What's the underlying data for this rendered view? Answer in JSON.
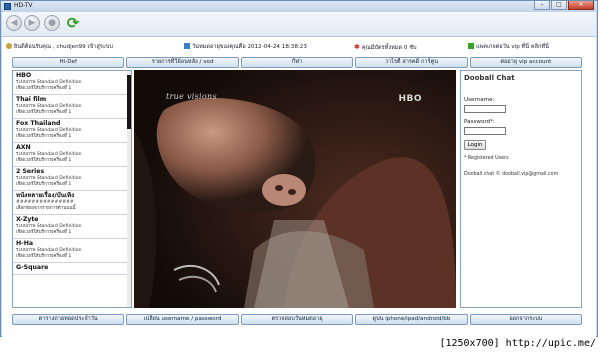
{
  "window": {
    "title": "HD-TV",
    "controls": [
      "–",
      "□",
      "✕"
    ]
  },
  "toolbar": {
    "icons": [
      "back-arrow-icon",
      "forward-arrow-icon",
      "stop-icon",
      "refresh-icon"
    ]
  },
  "infobar": {
    "welcome": "ยินดีต้อนรับคุณ , chudjen99 เข้าสู่ระบบ",
    "expiry": "วันหมดอายุของคุณคือ 2012-04-24 18:38:23",
    "points": "คุณมีบัตรทั้งหมด 0 ซับ",
    "vip": "แพคเกจต่อวัน vip ที่นี่ คลิกที่นี่",
    "colors": {
      "expiry_icon": "#3a7fc7",
      "points_icon": "#d02020",
      "vip_icon": "#3aa02c"
    }
  },
  "nav": [
    "Hi-Def",
    "รายการทีวีย้อนหลัง / vod",
    "กีฬา",
    "วาไรตี้ สารคดี การ์ตูน",
    "ต่ออายุ vip account"
  ],
  "channels": [
    {
      "name": "HBO",
      "l1": "ระบบภาพ Standard Definition",
      "l2": "เซิฟเวอร์ให้บริการเครื่องที่ 1"
    },
    {
      "name": "Thai film",
      "l1": "ระบบภาพ Standard Definition",
      "l2": "เซิฟเวอร์ให้บริการเครื่องที่ 1"
    },
    {
      "name": "Fox Thailand",
      "l1": "ระบบภาพ Standard Definition",
      "l2": "เซิฟเวอร์ให้บริการเครื่องที่ 1"
    },
    {
      "name": "AXN",
      "l1": "ระบบภาพ Standard Definition",
      "l2": "เซิฟเวอร์ให้บริการเครื่องที่ 1"
    },
    {
      "name": "2 Series",
      "l1": "ระบบภาพ Standard Definition",
      "l2": "เซิฟเวอร์ให้บริการเครื่องที่ 1"
    },
    {
      "name": "หนังหลายเรื่อง/บันเทิง",
      "l1": "###############",
      "l2": "เลือกช่องจากรายการด้านบนนี้"
    },
    {
      "name": "X-Zyte",
      "l1": "ระบบภาพ Standard Definition",
      "l2": "เซิฟเวอร์ให้บริการเครื่องที่ 1"
    },
    {
      "name": "H-Ha",
      "l1": "ระบบภาพ Standard Definition",
      "l2": "เซิฟเวอร์ให้บริการเครื่องที่ 1"
    },
    {
      "name": "G-Square",
      "l1": "",
      "l2": ""
    }
  ],
  "player": {
    "channel_logo": "true visions",
    "network_logo": "HBO"
  },
  "chat": {
    "title": "Dooball Chat",
    "username_label": "Username:",
    "password_label": "Password*:",
    "login_button": "Login",
    "note": "* Registered Users",
    "footer": "Dooball chat © dooball.vip@gmail.com"
  },
  "footer": [
    "ตารางถ่ายทอดประจำวัน",
    "เปลี่ยน username / password",
    "ตรวจสอบวันหมดอายุ",
    "ดูบน iphone/ipad/android/bb",
    "ออกจากระบบ"
  ],
  "caption": "[1250x700] http://upic.me/"
}
